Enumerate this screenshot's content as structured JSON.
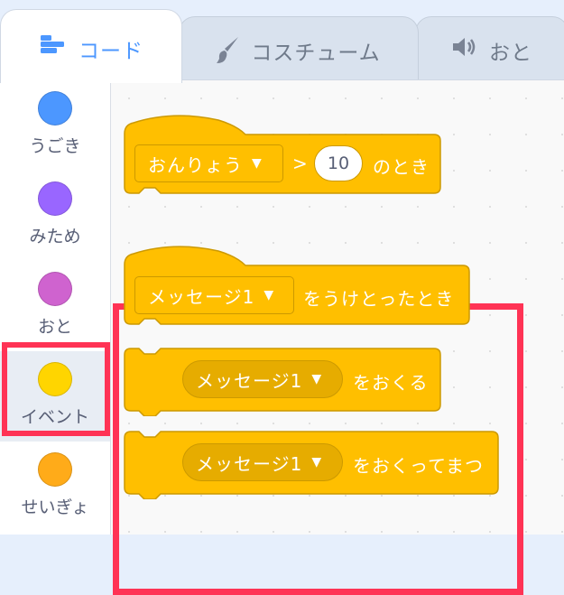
{
  "tabs": [
    {
      "label": "コード",
      "icon": "code-icon",
      "active": true
    },
    {
      "label": "コスチューム",
      "icon": "brush-icon",
      "active": false
    },
    {
      "label": "おと",
      "icon": "speaker-icon",
      "active": false
    }
  ],
  "categories": [
    {
      "label": "うごき",
      "color": "#4c97ff"
    },
    {
      "label": "みため",
      "color": "#9966ff"
    },
    {
      "label": "おと",
      "color": "#cf63cf"
    },
    {
      "label": "イベント",
      "color": "#ffd500"
    },
    {
      "label": "せいぎょ",
      "color": "#ffab19"
    }
  ],
  "blocks": {
    "when_greater": {
      "dropdown": "おんりょう",
      "operator": ">",
      "value": "10",
      "suffix": "のとき"
    },
    "when_receive": {
      "dropdown": "メッセージ1",
      "suffix": "をうけとったとき"
    },
    "broadcast": {
      "dropdown": "メッセージ1",
      "suffix": "をおくる"
    },
    "broadcast_wait": {
      "dropdown": "メッセージ1",
      "suffix": "をおくってまつ"
    }
  },
  "colors": {
    "event": "#ffbf00",
    "event_border": "#cc9900",
    "highlight": "#ff3355",
    "active_tab": "#4c97ff"
  }
}
